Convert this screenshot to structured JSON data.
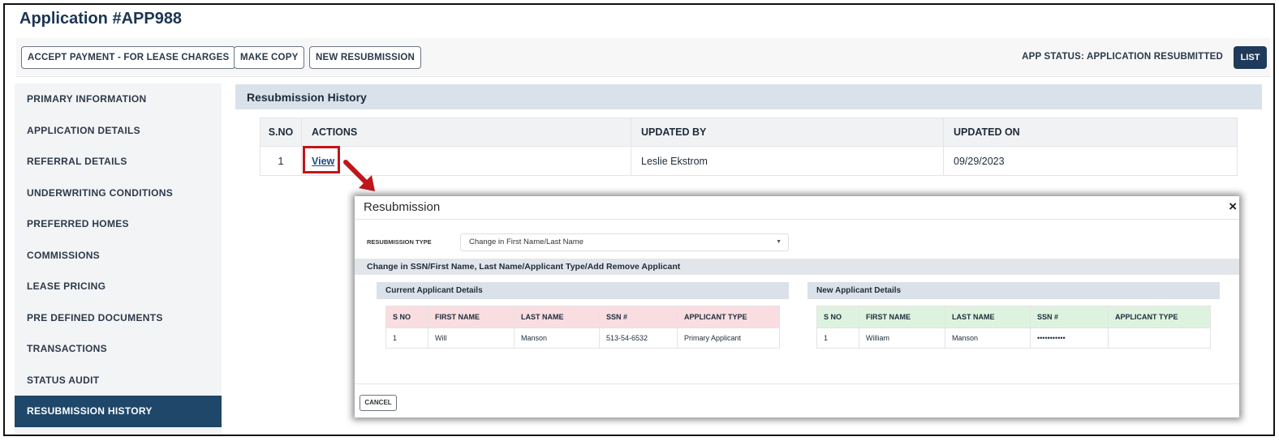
{
  "app": {
    "title": "Application #APP988"
  },
  "toolbar": {
    "accept_payment": "ACCEPT PAYMENT - FOR LEASE CHARGES",
    "make_copy": "MAKE COPY",
    "new_resubmission": "NEW RESUBMISSION",
    "status": "APP STATUS: APPLICATION RESUBMITTED",
    "list": "LIST"
  },
  "sidebar": {
    "items": [
      {
        "label": "PRIMARY INFORMATION"
      },
      {
        "label": "APPLICATION DETAILS"
      },
      {
        "label": "REFERRAL DETAILS"
      },
      {
        "label": "UNDERWRITING CONDITIONS"
      },
      {
        "label": "PREFERRED HOMES"
      },
      {
        "label": "COMMISSIONS"
      },
      {
        "label": "LEASE PRICING"
      },
      {
        "label": "PRE DEFINED DOCUMENTS"
      },
      {
        "label": "TRANSACTIONS"
      },
      {
        "label": "STATUS AUDIT"
      },
      {
        "label": "RESUBMISSION HISTORY",
        "active": true
      }
    ]
  },
  "main": {
    "section_title": "Resubmission History",
    "history_table": {
      "headers": [
        "S.NO",
        "ACTIONS",
        "UPDATED BY",
        "UPDATED ON"
      ],
      "rows": [
        {
          "sno": "1",
          "action": "View",
          "updated_by": "Leslie Ekstrom",
          "updated_on": "09/29/2023"
        }
      ]
    }
  },
  "modal": {
    "title": "Resubmission",
    "close": "×",
    "resubmission_type_label": "RESUBMISSION TYPE",
    "resubmission_type_value": "Change in First Name/Last Name",
    "change_bar": "Change in SSN/First Name, Last Name/Applicant Type/Add Remove Applicant",
    "current": {
      "title": "Current Applicant Details",
      "headers": [
        "S NO",
        "FIRST NAME",
        "LAST NAME",
        "SSN #",
        "APPLICANT TYPE"
      ],
      "rows": [
        [
          "1",
          "Will",
          "Manson",
          "513-54-6532",
          "Primary Applicant"
        ]
      ]
    },
    "new": {
      "title": "New Applicant Details",
      "headers": [
        "S NO",
        "FIRST NAME",
        "LAST NAME",
        "SSN #",
        "APPLICANT TYPE"
      ],
      "rows": [
        [
          "1",
          "William",
          "Manson",
          "•••••••••••",
          ""
        ]
      ]
    },
    "cancel": "CANCEL"
  },
  "colors": {
    "primary_navy": "#1e4769",
    "highlight_red": "#c0161b",
    "current_header_pink": "#fadde0",
    "new_header_green": "#def3df"
  }
}
